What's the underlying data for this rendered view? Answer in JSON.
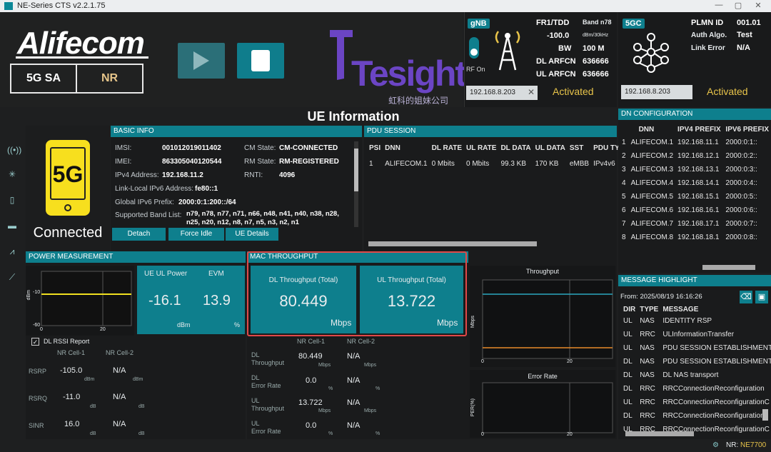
{
  "titlebar": {
    "title": "NE-Series CTS  v2.2.1.75",
    "min": "—",
    "restore": "▢",
    "close": "✕"
  },
  "brand": {
    "name": "Alifecom",
    "mode": "5G SA",
    "rat": "NR"
  },
  "tesight": {
    "word": "Tesight",
    "sub": "虹科的姐妹公司"
  },
  "gnb": {
    "tag": "gNB",
    "rf": "RF On",
    "rows": [
      [
        "FR1/TDD",
        "Band n78"
      ],
      [
        "-100.0",
        "dBm/30kHz"
      ],
      [
        "BW",
        "100 M"
      ],
      [
        "DL ARFCN",
        "636666"
      ],
      [
        "UL ARFCN",
        "636666"
      ]
    ],
    "ip": "192.168.8.203",
    "status": "Activated"
  },
  "gc": {
    "tag": "5GC",
    "rows": [
      [
        "PLMN ID",
        "001.01"
      ],
      [
        "Auth Algo.",
        "Test"
      ],
      [
        "Link Error",
        "N/A"
      ]
    ],
    "ip": "192.168.8.203",
    "status": "Activated"
  },
  "ue_title": "UE Information",
  "card": {
    "big": "5G",
    "status": "Connected"
  },
  "basic": {
    "title": "BASIC INFO",
    "imsi_l": "IMSI:",
    "imsi": "001012019011402",
    "imei_l": "IMEI:",
    "imei": "863305040120544",
    "ipv4_l": "IPv4 Address:",
    "ipv4": "192.168.11.2",
    "ll_l": "Link-Local IPv6 Address:",
    "ll": "fe80::1",
    "g6_l": "Global IPv6 Prefix:",
    "g6": "2000:0:1:200::/64",
    "band_l": "Supported Band List:",
    "band1": "n79, n78, n77, n71, n66, n48, n41, n40, n38, n28,",
    "band2": "n25, n20, n12, n8, n7, n5, n3, n2, n1",
    "cm_l": "CM State:",
    "cm": "CM-CONNECTED",
    "rm_l": "RM State:",
    "rm": "RM-REGISTERED",
    "rnti_l": "RNTI:",
    "rnti": "4096",
    "b_detach": "Detach",
    "b_idle": "Force Idle",
    "b_details": "UE Details"
  },
  "pdu": {
    "title": "PDU SESSION",
    "headers": [
      "PSI",
      "DNN",
      "DL RATE",
      "UL RATE",
      "DL DATA",
      "UL DATA",
      "SST",
      "PDU TYPE"
    ],
    "row": [
      "1",
      "ALIFECOM.1",
      "0 Mbits",
      "0 Mbits",
      "99.3 KB",
      "170 KB",
      "eMBB",
      "IPv4v6"
    ]
  },
  "dn": {
    "title": "DN CONFIGURATION",
    "headers": [
      "DNN",
      "IPV4 PREFIX",
      "IPV6 PREFIX"
    ],
    "rows": [
      [
        "1",
        "ALIFECOM.1",
        "192.168.11.1",
        "2000:0:1::"
      ],
      [
        "2",
        "ALIFECOM.2",
        "192.168.12.1",
        "2000:0:2::"
      ],
      [
        "3",
        "ALIFECOM.3",
        "192.168.13.1",
        "2000:0:3::"
      ],
      [
        "4",
        "ALIFECOM.4",
        "192.168.14.1",
        "2000:0:4::"
      ],
      [
        "5",
        "ALIFECOM.5",
        "192.168.15.1",
        "2000:0:5::"
      ],
      [
        "6",
        "ALIFECOM.6",
        "192.168.16.1",
        "2000:0:6::"
      ],
      [
        "7",
        "ALIFECOM.7",
        "192.168.17.1",
        "2000:0:7::"
      ],
      [
        "8",
        "ALIFECOM.8",
        "192.168.18.1",
        "2000:0:8::"
      ]
    ]
  },
  "power": {
    "title": "POWER MEASUREMENT",
    "ylabel": "dBm",
    "t10": "-10",
    "t60": "-60",
    "x0": "0",
    "x20": "20",
    "ul_l": "UE UL Power",
    "evm_l": "EVM",
    "ul": "-16.1",
    "evm": "13.9",
    "u1": "dBm",
    "u2": "%",
    "rssi": "DL RSSI Report",
    "c1": "NR Cell-1",
    "c2": "NR Cell-2",
    "rsrp_l": "RSRP",
    "rsrp1": "-105.0",
    "rsrp2": "N/A",
    "rsrp_u": "dBm",
    "rsrq_l": "RSRQ",
    "rsrq1": "-11.0",
    "rsrq2": "N/A",
    "rsrq_u": "dB",
    "sinr_l": "SINR",
    "sinr1": "16.0",
    "sinr2": "N/A",
    "sinr_u": "dB"
  },
  "mac": {
    "title": "MAC THROUGHPUT",
    "dl_l": "DL Throughput (Total)",
    "dl": "80.449",
    "ul_l": "UL Throughput (Total)",
    "ul": "13.722",
    "unit": "Mbps",
    "c1": "NR Cell-1",
    "c2": "NR Cell-2",
    "dlt_l": "DL\nThroughput",
    "dlt1": "80.449",
    "dlt2": "N/A",
    "mb": "Mbps",
    "dle_l": "DL\nError Rate",
    "dle1": "0.0",
    "dle2": "N/A",
    "pc": "%",
    "ult_l": "UL\nThroughput",
    "ult1": "13.722",
    "ult2": "N/A",
    "ule_l": "UL\nError Rate",
    "ule1": "0.0",
    "ule2": "N/A"
  },
  "charts": {
    "tp_title": "Throughput",
    "tp_y": "Mbps",
    "er_title": "Error Rate",
    "er_y": "PER(%)",
    "x0": "0",
    "x20": "20"
  },
  "msg": {
    "title": "MESSAGE HIGHLIGHT",
    "from": "From: 2025/08/19 16:16:26",
    "headers": [
      "DIR",
      "TYPE",
      "MESSAGE"
    ],
    "rows": [
      [
        "UL",
        "NAS",
        "IDENTITY RSP"
      ],
      [
        "UL",
        "RRC",
        "ULInformationTransfer"
      ],
      [
        "UL",
        "NAS",
        "PDU SESSION ESTABLISHMENT R"
      ],
      [
        "DL",
        "NAS",
        "PDU SESSION ESTABLISHMENT A"
      ],
      [
        "DL",
        "NAS",
        "DL NAS transport"
      ],
      [
        "DL",
        "RRC",
        "RRCConnectionReconfiguration"
      ],
      [
        "UL",
        "RRC",
        "RRCConnectionReconfigurationC"
      ],
      [
        "DL",
        "RRC",
        "RRCConnectionReconfiguration"
      ],
      [
        "UL",
        "RRC",
        "RRCConnectionReconfigurationC"
      ]
    ]
  },
  "status": {
    "nr": "NR:",
    "dev": "NE7700"
  },
  "colors": {
    "teal": "#0e7f8d",
    "accent": "#e8c44a",
    "highlight": "#e04848"
  }
}
